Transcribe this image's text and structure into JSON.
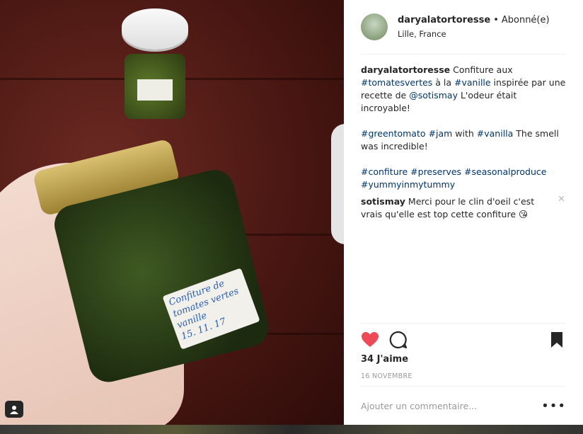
{
  "post": {
    "username": "daryalatortoresse",
    "follow_status": "Abonné(e)",
    "location": "Lille, France",
    "jar_label_lines": [
      "Confiture de",
      "tomates vertes",
      "vanille",
      "15. 11. 17"
    ]
  },
  "caption": {
    "author": "daryalatortoresse",
    "p1": {
      "t1": " Confiture aux ",
      "tag1": "#tomatesvertes",
      "t2": " à la ",
      "tag2": "#vanille",
      "t3": " inspirée par une recette de ",
      "mention": "@sotismay",
      "t4": " L'odeur était incroyable!"
    },
    "p2": {
      "tag1": "#greentomato",
      "tag2": "#jam",
      "t1": " with ",
      "tag3": "#vanilla",
      "t2": " The smell was incredible!"
    },
    "p3": {
      "tag1": "#confiture",
      "tag2": "#preserves",
      "tag3": "#seasonalproduce",
      "tag4": "#yummyinmytummy"
    }
  },
  "comment": {
    "author": "sotismay",
    "text": " Merci pour le clin d'oeil c'est vrais qu'elle est top cette confiture 😘"
  },
  "likes": "34 J'aime",
  "date": "16 NOVEMBRE",
  "comment_input": {
    "placeholder": "Ajouter un commentaire..."
  },
  "more_label": "•••",
  "icons": {
    "like": "heart-icon",
    "comment": "comment-icon",
    "save": "bookmark-icon",
    "user_tag": "user-tag-icon",
    "remove": "close-icon"
  },
  "colors": {
    "heart": "#ed4956",
    "link": "#003569",
    "muted": "#999999"
  }
}
